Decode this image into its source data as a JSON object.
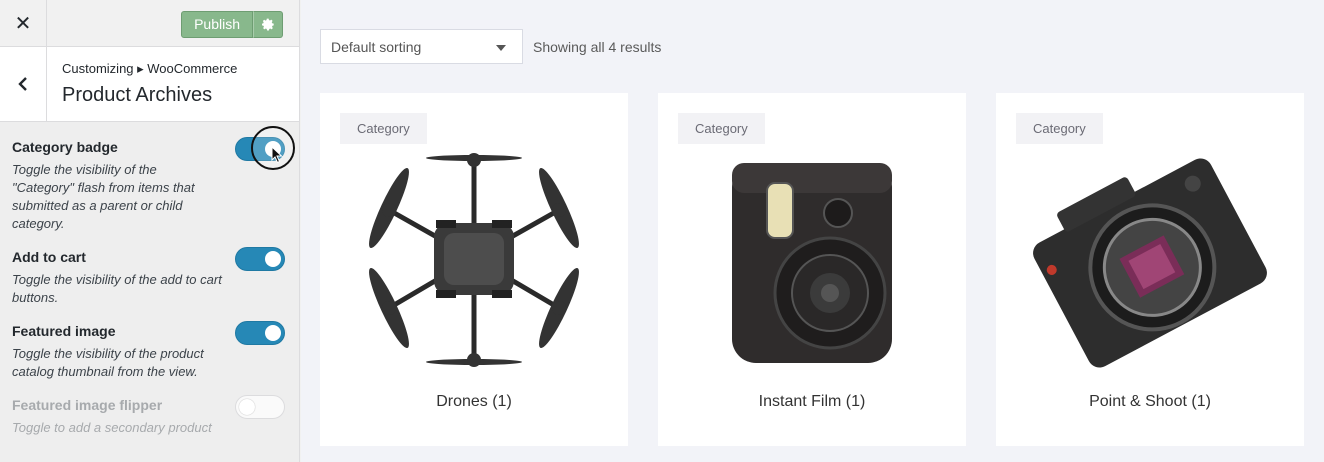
{
  "topbar": {
    "close_icon": "close-icon",
    "publish_label": "Publish",
    "settings_icon": "gear-icon"
  },
  "section": {
    "breadcrumb": "Customizing ▸ WooCommerce",
    "title": "Product Archives",
    "back_icon": "chevron-left-icon"
  },
  "controls": [
    {
      "title": "Category badge",
      "desc": "Toggle the visibility of the \"Category\" flash from items that submitted as a parent or child category.",
      "enabled": true
    },
    {
      "title": "Add to cart",
      "desc": "Toggle the visibility of the add to cart buttons.",
      "enabled": true
    },
    {
      "title": "Featured image",
      "desc": "Toggle the visibility of the product catalog thumbnail from the view.",
      "enabled": true
    },
    {
      "title": "Featured image flipper",
      "desc": "Toggle to add a secondary product",
      "enabled": false
    }
  ],
  "preview": {
    "sorting": "Default sorting",
    "result_count": "Showing all 4 results",
    "cards": [
      {
        "badge": "Category",
        "title": "Drones (1)",
        "image": "drone-image"
      },
      {
        "badge": "Category",
        "title": "Instant Film (1)",
        "image": "instant-camera-image"
      },
      {
        "badge": "Category",
        "title": "Point & Shoot (1)",
        "image": "mirrorless-camera-image"
      }
    ]
  },
  "colors": {
    "accent": "#2688b6",
    "publish": "#88b88c"
  }
}
